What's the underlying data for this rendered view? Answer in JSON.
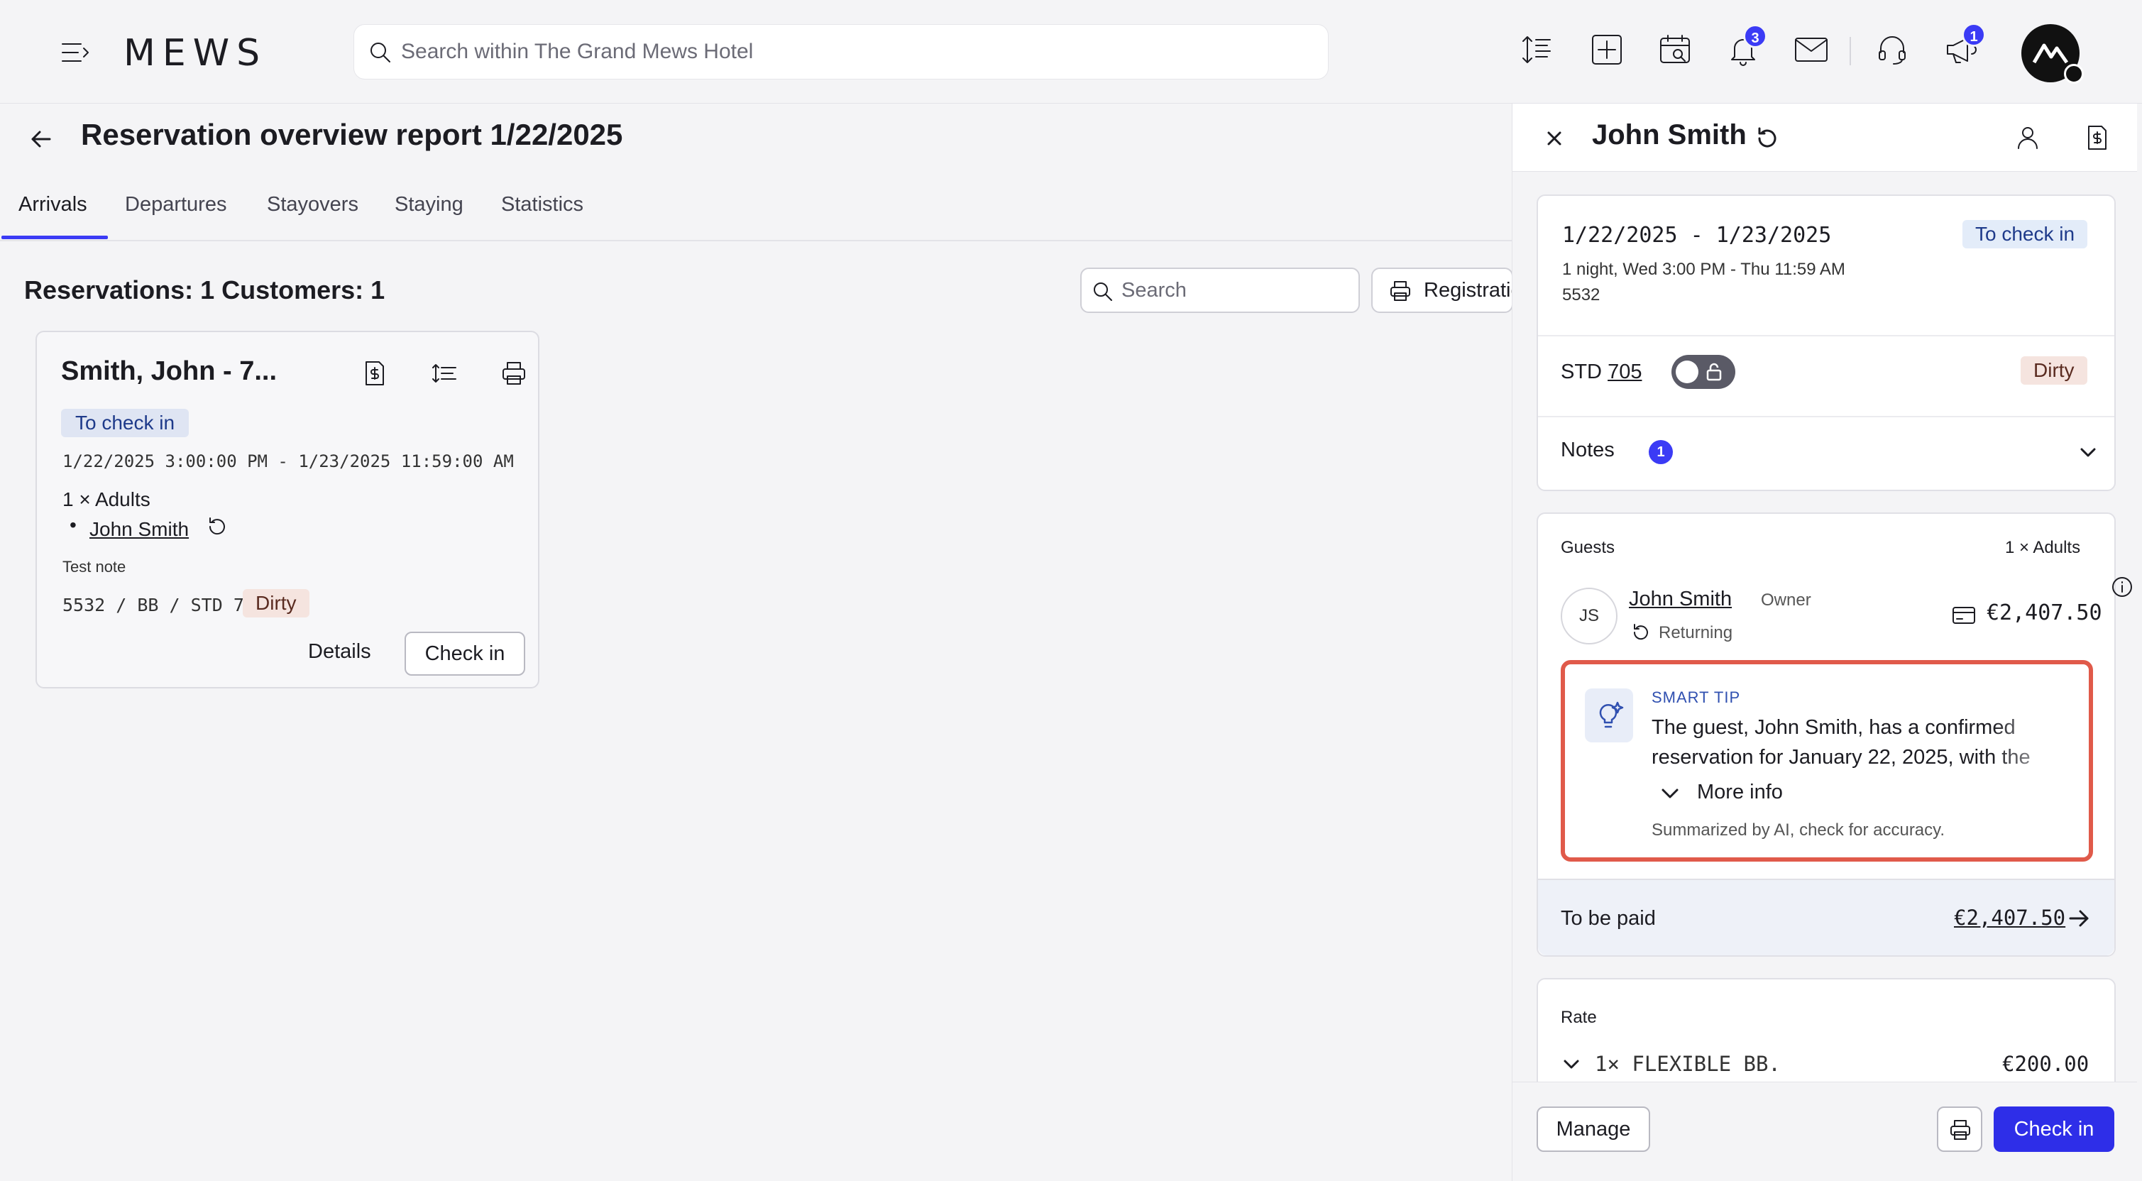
{
  "topbar": {
    "logo_text": "MEWS",
    "search_placeholder": "Search within The Grand Mews Hotel",
    "notifications_count": "3",
    "announcements_count": "1",
    "icons": [
      "menu-icon",
      "sort-icon",
      "add-icon",
      "calendar-icon",
      "bell-icon",
      "mail-icon",
      "headset-icon",
      "megaphone-icon"
    ]
  },
  "page": {
    "title": "Reservation overview report 1/22/2025",
    "tabs": [
      {
        "label": "Arrivals"
      },
      {
        "label": "Departures"
      },
      {
        "label": "Stayovers"
      },
      {
        "label": "Staying"
      },
      {
        "label": "Statistics"
      }
    ],
    "summary": "Reservations: 1 Customers: 1",
    "search_placeholder": "Search",
    "registration_label": "Registration"
  },
  "card": {
    "title": "Smith, John - 7...",
    "status": "To check in",
    "dates": "1/22/2025 3:00:00 PM - 1/23/2025 11:59:00 AM",
    "adults": "1 × Adults",
    "guest": "John Smith",
    "note": "Test note",
    "room": "5532 / BB / STD 705",
    "room_status": "Dirty",
    "details_label": "Details",
    "checkin_label": "Check in"
  },
  "panel": {
    "title": "John Smith",
    "dates": "1/22/2025 - 1/23/2025",
    "status": "To check in",
    "nights": "1 night, Wed 3:00 PM - Thu 11:59 AM",
    "number": "5532",
    "room_type": "STD",
    "room_number": "705",
    "room_status": "Dirty",
    "notes_label": "Notes",
    "notes_count": "1",
    "guests_label": "Guests",
    "guests_count": "1 × Adults",
    "guest_initials": "JS",
    "guest_name": "John Smith",
    "guest_role": "Owner",
    "guest_returning": "Returning",
    "guest_amount": "€2,407.50",
    "smart_tip": {
      "label": "SMART TIP",
      "text": "The guest, John Smith, has a confirmed reservation for January 22, 2025, with the",
      "more_label": "More info",
      "disclaimer": "Summarized by AI, check for accuracy."
    },
    "to_be_paid_label": "To be paid",
    "to_be_paid_amount": "€2,407.50",
    "rate_label": "Rate",
    "rate_name": "1× FLEXIBLE BB.",
    "rate_amount": "€200.00",
    "manage_label": "Manage",
    "checkin_label": "Check in"
  },
  "colors": {
    "accent": "#3b3bf5",
    "primary_button": "#2e2ee8",
    "highlight_border": "#e05a4a",
    "status_blue_bg": "#e3ecf9",
    "dirty_bg": "#f5e4df"
  }
}
